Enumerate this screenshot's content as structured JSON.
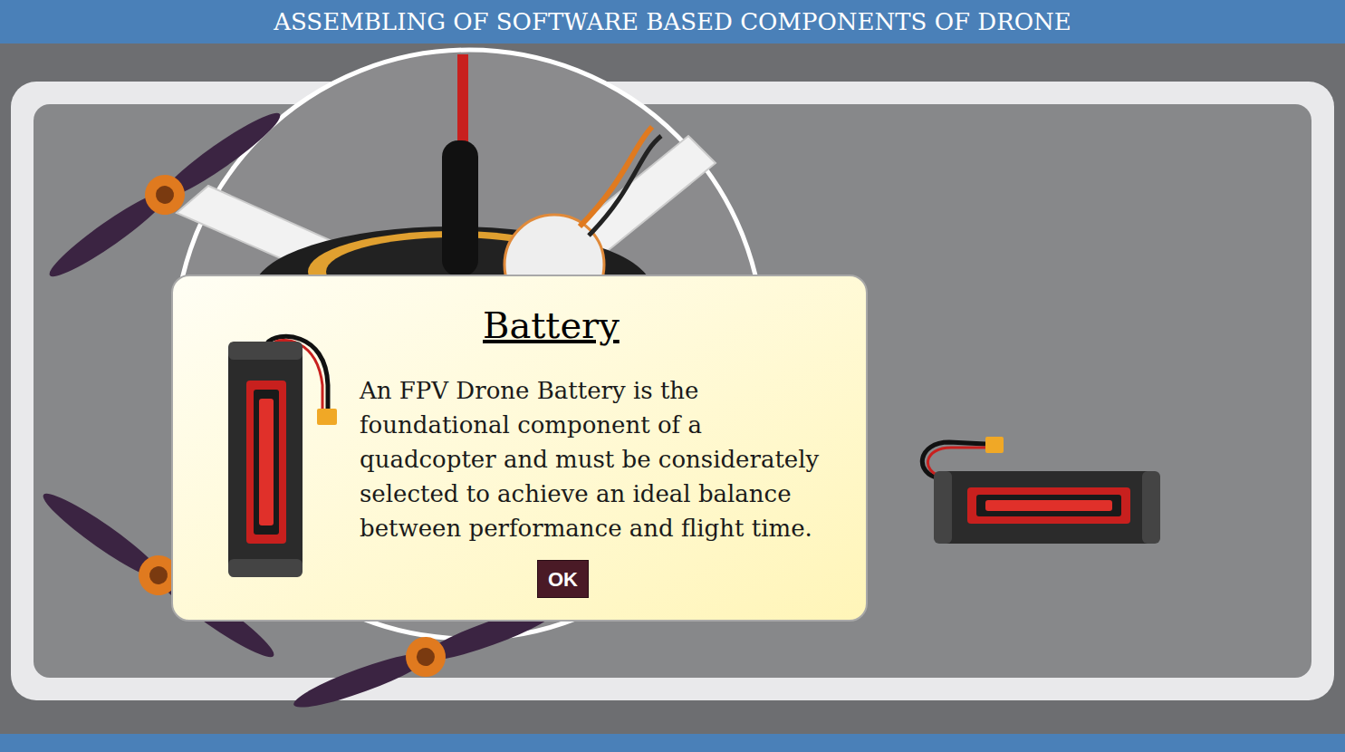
{
  "header": {
    "title": "ASSEMBLING OF SOFTWARE BASED COMPONENTS OF DRONE"
  },
  "dialog": {
    "title": "Battery",
    "body": "An FPV Drone Battery is the foundational component of a quadcopter and must be considerately selected to achieve an ideal balance between performance and flight time.",
    "buttons": [
      "OK"
    ]
  }
}
